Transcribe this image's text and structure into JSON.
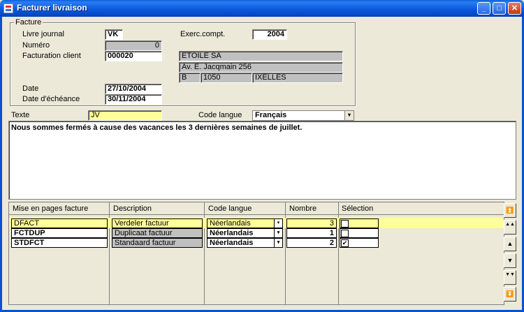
{
  "window": {
    "title": "Facturer livraison",
    "controls": {
      "minimize": "_",
      "maximize": "□",
      "close": "✕"
    }
  },
  "facture": {
    "group_label": "Facture",
    "livre_journal_label": "Livre journal",
    "livre_journal_value": "VK",
    "exerc_label": "Exerc.compt.",
    "exerc_value": "2004",
    "numero_label": "Numéro",
    "numero_value": "0",
    "facturation_label": "Facturation client",
    "facturation_value": "000020",
    "client_name": "ETOILE SA",
    "client_address": "Av. E. Jacqmain 256",
    "client_country": "B",
    "client_postcode": "1050",
    "client_city": "IXELLES",
    "date_label": "Date",
    "date_value": "27/10/2004",
    "echeance_label": "Date d'échéance",
    "echeance_value": "30/11/2004"
  },
  "texte": {
    "label": "Texte",
    "value": "JV",
    "code_langue_label": "Code langue",
    "code_langue_value": "Français",
    "body": "Nous sommes fermés à cause des vacances les 3 dernières semaines de juillet."
  },
  "grid": {
    "headers": [
      "Mise en pages facture",
      "Description",
      "Code langue",
      "Nombre",
      "Sélection"
    ],
    "rows": [
      {
        "mise": "DFACT",
        "description": "Verdeler factuur",
        "langue": "Néerlandais",
        "nombre": "3",
        "selection": ""
      },
      {
        "mise": "FCTDUP",
        "description": "Duplicaat factuur",
        "langue": "Néerlandais",
        "nombre": "1",
        "selection": ""
      },
      {
        "mise": "STDFCT",
        "description": "Standaard factuur",
        "langue": "Néerlandais",
        "nombre": "2",
        "selection": "✔"
      }
    ]
  },
  "nav": {
    "first": "⏫",
    "prev_page": "▲▲",
    "prev": "▲",
    "next": "▼",
    "next_page": "▼▼",
    "last": "⏬"
  }
}
